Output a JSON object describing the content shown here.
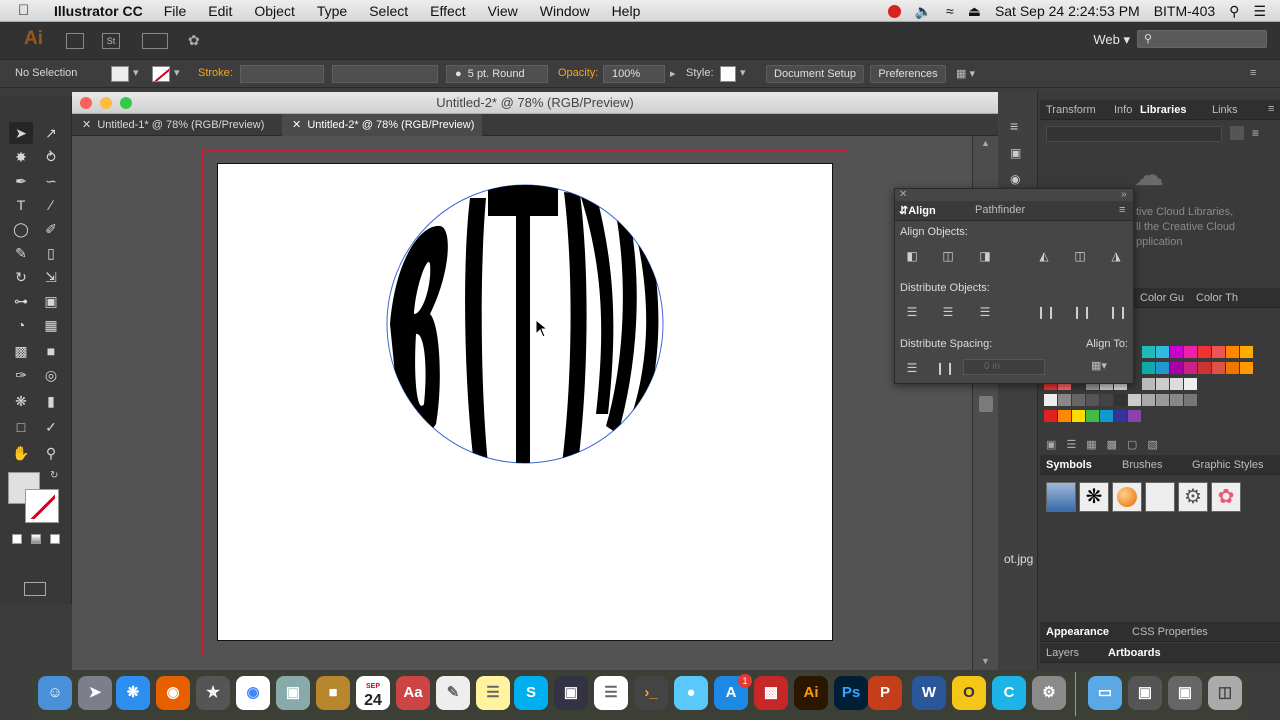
{
  "menubar": {
    "app": "Illustrator CC",
    "items": [
      "File",
      "Edit",
      "Object",
      "Type",
      "Select",
      "Effect",
      "View",
      "Window",
      "Help"
    ],
    "clock": "Sat Sep 24  2:24:53 PM",
    "user": "BITM-403"
  },
  "appbar": {
    "logo": "Ai",
    "workspace": "Web",
    "st_label": "St"
  },
  "control": {
    "selection": "No Selection",
    "stroke_label": "Stroke:",
    "brush": "5 pt. Round",
    "opacity_label": "Opacity:",
    "opacity_value": "100%",
    "style_label": "Style:",
    "document_setup": "Document Setup",
    "preferences": "Preferences"
  },
  "document": {
    "window_title": "Untitled-2* @ 78% (RGB/Preview)",
    "tabs": [
      {
        "label": "Untitled-1* @ 78% (RGB/Preview)"
      },
      {
        "label": "Untitled-2* @ 78% (RGB/Preview)"
      }
    ],
    "artwork_text": "BITM"
  },
  "panels": {
    "top_tabs": [
      "Transform",
      "Info",
      "Libraries",
      "Links"
    ],
    "libraries_msg": [
      "tive Cloud Libraries,",
      "ll the Creative Cloud",
      "pplication"
    ],
    "color_tabs": [
      "Color Gu",
      "Color Th"
    ],
    "align": {
      "tabs": [
        "Align",
        "Pathfinder"
      ],
      "align_objects": "Align Objects:",
      "distribute_objects": "Distribute Objects:",
      "distribute_spacing": "Distribute Spacing:",
      "align_to": "Align To:",
      "spacing_value": "0 in"
    },
    "symbols_tabs": [
      "Symbols",
      "Brushes",
      "Graphic Styles"
    ],
    "appearance_tabs": [
      "Appearance",
      "CSS Properties"
    ],
    "layers_tabs": [
      "Layers",
      "Artboards"
    ],
    "file_hint": "ot.jpg"
  },
  "colors": {
    "accent": "#f5a623",
    "bleed": "#c8202e",
    "ai_orange": "#ff7c00"
  },
  "macdock": {
    "calendar_day": "24",
    "calendar_month": "SEP",
    "badge": "1"
  }
}
